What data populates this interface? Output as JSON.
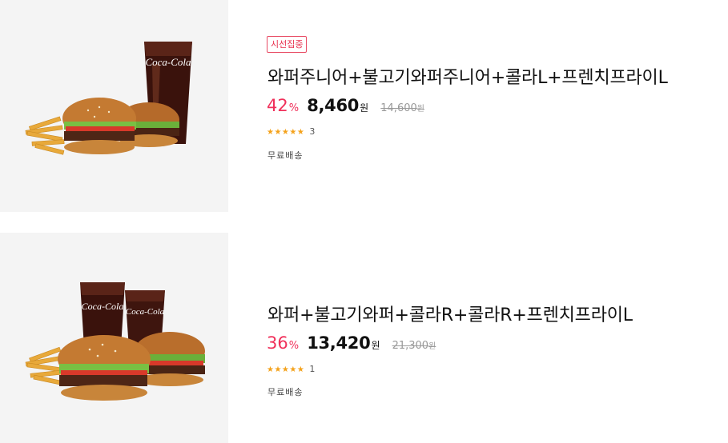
{
  "products": [
    {
      "badge": "시선집중",
      "title": "와퍼주니어+불고기와퍼주니어+콜라L+프렌치프라이L",
      "discount": "42",
      "discount_unit": "%",
      "price": "8,460",
      "currency": "원",
      "original_price": "14,600",
      "original_currency": "원",
      "stars": "★★★★★",
      "rating": 5,
      "review_count": "3",
      "shipping": "무료배송",
      "image_icon": "burger-set-image",
      "cup_text": "Coca-Cola"
    },
    {
      "title": "와퍼+불고기와퍼+콜라R+콜라R+프렌치프라이L",
      "discount": "36",
      "discount_unit": "%",
      "price": "13,420",
      "currency": "원",
      "original_price": "21,300",
      "original_currency": "원",
      "stars": "★★★★★",
      "rating": 5,
      "review_count": "1",
      "shipping": "무료배송",
      "image_icon": "burger-set-image",
      "cup_text": "Coca-Cola"
    }
  ],
  "colors": {
    "accent": "#f0305a",
    "star": "#f4a21b",
    "badge_border": "#e84a63",
    "thumb_bg": "#f4f4f4"
  }
}
